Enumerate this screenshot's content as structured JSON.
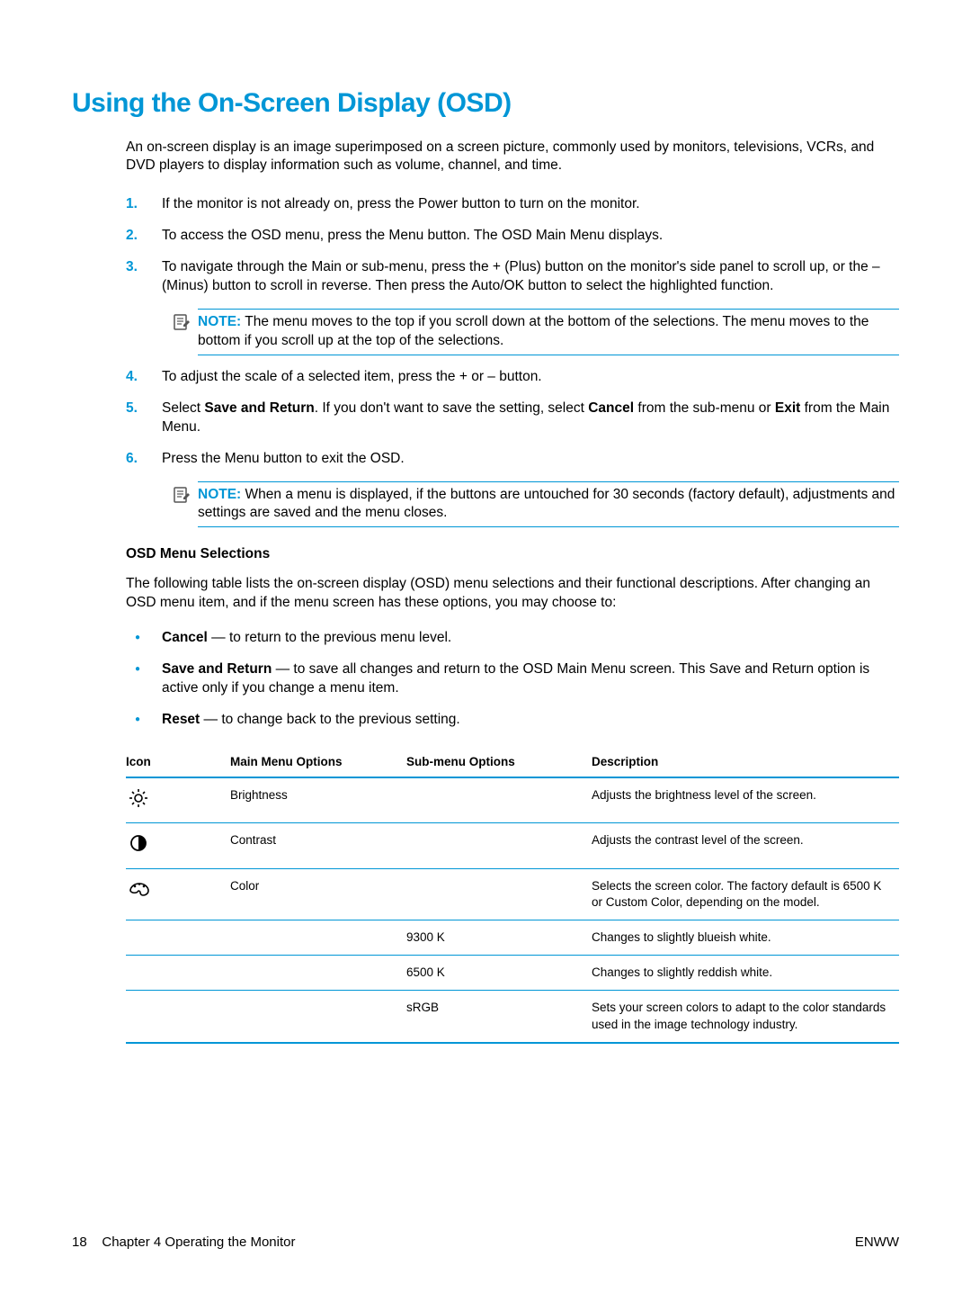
{
  "heading": "Using the On-Screen Display (OSD)",
  "intro": "An on-screen display is an image superimposed on a screen picture, commonly used by monitors, televisions, VCRs, and DVD players to display information such as volume, channel, and time.",
  "steps": {
    "s1": "If the monitor is not already on, press the Power button to turn on the monitor.",
    "s2": "To access the OSD menu, press the Menu button. The OSD Main Menu displays.",
    "s3": "To navigate through the Main or sub-menu, press the + (Plus) button on the monitor's side panel to scroll up, or the – (Minus) button to scroll in reverse. Then press the Auto/OK button to select the highlighted function.",
    "note1_label": "NOTE:",
    "note1_body": "The menu moves to the top if you scroll down at the bottom of the selections. The menu moves to the bottom if you scroll up at the top of the selections.",
    "s4": "To adjust the scale of a selected item, press the + or – button.",
    "s5_pre": "Select ",
    "s5_b1": "Save and Return",
    "s5_mid1": ". If you don't want to save the setting, select ",
    "s5_b2": "Cancel",
    "s5_mid2": " from the sub-menu or ",
    "s5_b3": "Exit",
    "s5_end": " from the Main Menu.",
    "s6": "Press the Menu button to exit the OSD.",
    "note2_label": "NOTE:",
    "note2_body": "When a menu is displayed, if the buttons are untouched for 30 seconds (factory default), adjustments and settings are saved and the menu closes."
  },
  "osd_sel_head": "OSD Menu Selections",
  "osd_sel_intro": "The following table lists the on-screen display (OSD) menu selections and their functional descriptions. After changing an OSD menu item, and if the menu screen has these options, you may choose to:",
  "bullets": {
    "b1_bold": "Cancel",
    "b1_rest": " — to return to the previous menu level.",
    "b2_bold": "Save and Return",
    "b2_rest": " — to save all changes and return to the OSD Main Menu screen. This Save and Return option is active only if you change a menu item.",
    "b3_bold": "Reset",
    "b3_rest": " — to change back to the previous setting."
  },
  "table": {
    "h_icon": "Icon",
    "h_main": "Main Menu Options",
    "h_sub": "Sub-menu Options",
    "h_desc": "Description",
    "rows": [
      {
        "icon": "brightness",
        "main": "Brightness",
        "sub": "",
        "desc": "Adjusts the brightness level of the screen."
      },
      {
        "icon": "contrast",
        "main": "Contrast",
        "sub": "",
        "desc": "Adjusts the contrast level of the screen."
      },
      {
        "icon": "color",
        "main": "Color",
        "sub": "",
        "desc": "Selects the screen color. The factory default is 6500 K or Custom Color, depending on the model."
      },
      {
        "icon": "",
        "main": "",
        "sub": "9300 K",
        "desc": "Changes to slightly blueish white."
      },
      {
        "icon": "",
        "main": "",
        "sub": "6500 K",
        "desc": "Changes to slightly reddish white."
      },
      {
        "icon": "",
        "main": "",
        "sub": "sRGB",
        "desc": "Sets your screen colors to adapt to the color standards used in the image technology industry."
      }
    ]
  },
  "footer": {
    "page_num": "18",
    "chapter": "Chapter 4   Operating the Monitor",
    "right": "ENWW"
  }
}
